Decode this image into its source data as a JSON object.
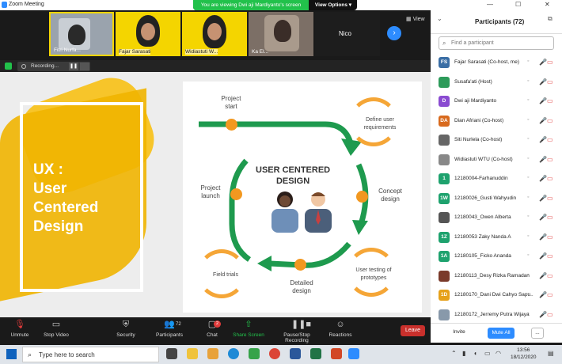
{
  "window": {
    "title": "Zoom Meeting"
  },
  "banner": {
    "viewing": "You are viewing Dwi aji Mardiyanto's screen",
    "options": "View Options"
  },
  "strip": {
    "tiles": [
      {
        "label": "Fitri Nurfa..."
      },
      {
        "label": "Fajar Sarasati"
      },
      {
        "label": "Widiastuti W..."
      },
      {
        "label": "Ka El..."
      },
      {
        "label": "Nico"
      }
    ],
    "view_label": "View"
  },
  "recording": {
    "label": "Recording..."
  },
  "slide_left": {
    "title": "UX :\nUser\nCentered\nDesign"
  },
  "diagram": {
    "center_line1": "USER CENTERED",
    "center_line2": "DESIGN",
    "project_start": "Project\nstart",
    "define": "Define user\nrequirements",
    "concept": "Concept\ndesign",
    "user_testing": "User testing of\nprototypes",
    "detailed": "Detailed\ndesign",
    "field_trials": "Field trials",
    "launch": "Project\nlaunch"
  },
  "participants": {
    "header": "Participants (72)",
    "search_placeholder": "Find a participant",
    "items": [
      {
        "initials": "FS",
        "name": "Fajar Sarasati (Co-host, me)",
        "color": "#3a6ea5"
      },
      {
        "initials": "",
        "name": "Susafa'ati (Host)",
        "color": "#2d9b5a"
      },
      {
        "initials": "D",
        "name": "Dwi aji Mardiyanto",
        "color": "#8a4bd1"
      },
      {
        "initials": "DA",
        "name": "Dian Afriani (Co-host)",
        "color": "#d86a1e"
      },
      {
        "initials": "",
        "name": "Siti Nurlela (Co-host)",
        "color": "#666666"
      },
      {
        "initials": "",
        "name": "Widiastuti WTU (Co-host)",
        "color": "#888888"
      },
      {
        "initials": "1",
        "name": "12180004-Farhanuddin",
        "color": "#1ea26e"
      },
      {
        "initials": "1W",
        "name": "12180026_Gusti Wahyudin",
        "color": "#1ea26e"
      },
      {
        "initials": "",
        "name": "12180043_Owen Alberta",
        "color": "#555555"
      },
      {
        "initials": "1Z",
        "name": "12180053 Zaky Nanda A",
        "color": "#1ea26e"
      },
      {
        "initials": "1A",
        "name": "12180105_Ficko Ananda",
        "color": "#1ea26e"
      },
      {
        "initials": "",
        "name": "12180113_Desy Rizka Ramadan",
        "color": "#7a3a2a"
      },
      {
        "initials": "1D",
        "name": "12180170_Dani Dwi Cahyo Sapu...",
        "color": "#e6a11b"
      },
      {
        "initials": "",
        "name": "12180172_Jerremy Putra Wijaya",
        "color": "#8899aa"
      }
    ],
    "invite": "Invite",
    "mute_all": "Mute All",
    "more": "..."
  },
  "toolbar": {
    "unmute": "Unmute",
    "stop_video": "Stop Video",
    "security": "Security",
    "participants": "Participants",
    "participants_count": "72",
    "chat": "Chat",
    "chat_badge": "2",
    "share_screen": "Share Screen",
    "record": "Pause/Stop Recording",
    "reactions": "Reactions",
    "leave": "Leave"
  },
  "taskbar": {
    "search_placeholder": "Type here to search",
    "time": "13:56",
    "date": "18/12/2020"
  }
}
